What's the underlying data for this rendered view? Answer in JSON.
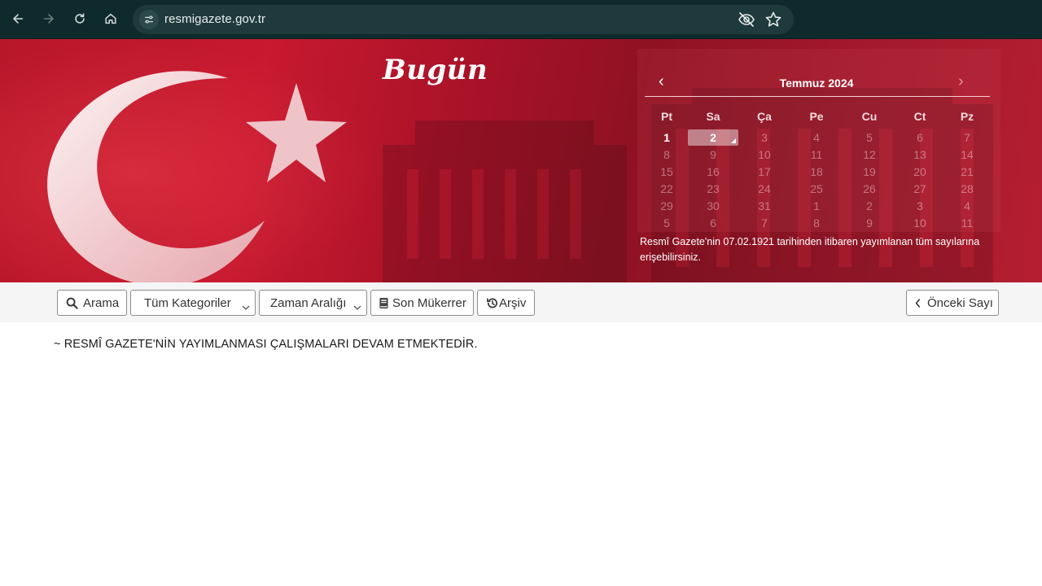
{
  "browser": {
    "url": "resmigazete.gov.tr",
    "icons": [
      "back-icon",
      "forward-icon",
      "reload-icon",
      "home-icon",
      "site-settings-icon",
      "eye-off-icon",
      "star-icon"
    ]
  },
  "banner": {
    "heading": "Bugün",
    "note": "Resmî Gazete'nin 07.02.1921 tarihinden itibaren yayımlanan tüm sayılarına erişebilirsiniz."
  },
  "calendar": {
    "month_label": "Temmuz 2024",
    "weekdays": [
      "Pt",
      "Sa",
      "Ça",
      "Pe",
      "Cu",
      "Ct",
      "Pz"
    ],
    "selected_day": "2",
    "weeks": [
      [
        "1",
        "2",
        "3",
        "4",
        "5",
        "6",
        "7"
      ],
      [
        "8",
        "9",
        "10",
        "11",
        "12",
        "13",
        "14"
      ],
      [
        "15",
        "16",
        "17",
        "18",
        "19",
        "20",
        "21"
      ],
      [
        "22",
        "23",
        "24",
        "25",
        "26",
        "27",
        "28"
      ],
      [
        "29",
        "30",
        "31",
        "1",
        "2",
        "3",
        "4"
      ],
      [
        "5",
        "6",
        "7",
        "8",
        "9",
        "10",
        "11"
      ]
    ]
  },
  "toolbar": {
    "search_label": "Arama",
    "category_label": "Tüm Kategoriler",
    "date_range_label": "Zaman Aralığı",
    "latest_duplicate_label": "Son Mükerrer",
    "archive_label": "Arşiv",
    "previous_issue_label": "Önceki Sayı"
  },
  "content": {
    "notice": "~ RESMÎ GAZETE'NİN YAYIMLANMASI ÇALIŞMALARI DEVAM ETMEKTEDİR."
  },
  "colors": {
    "banner_red": "#b8172a",
    "chrome_bg": "#0f2a2c"
  }
}
